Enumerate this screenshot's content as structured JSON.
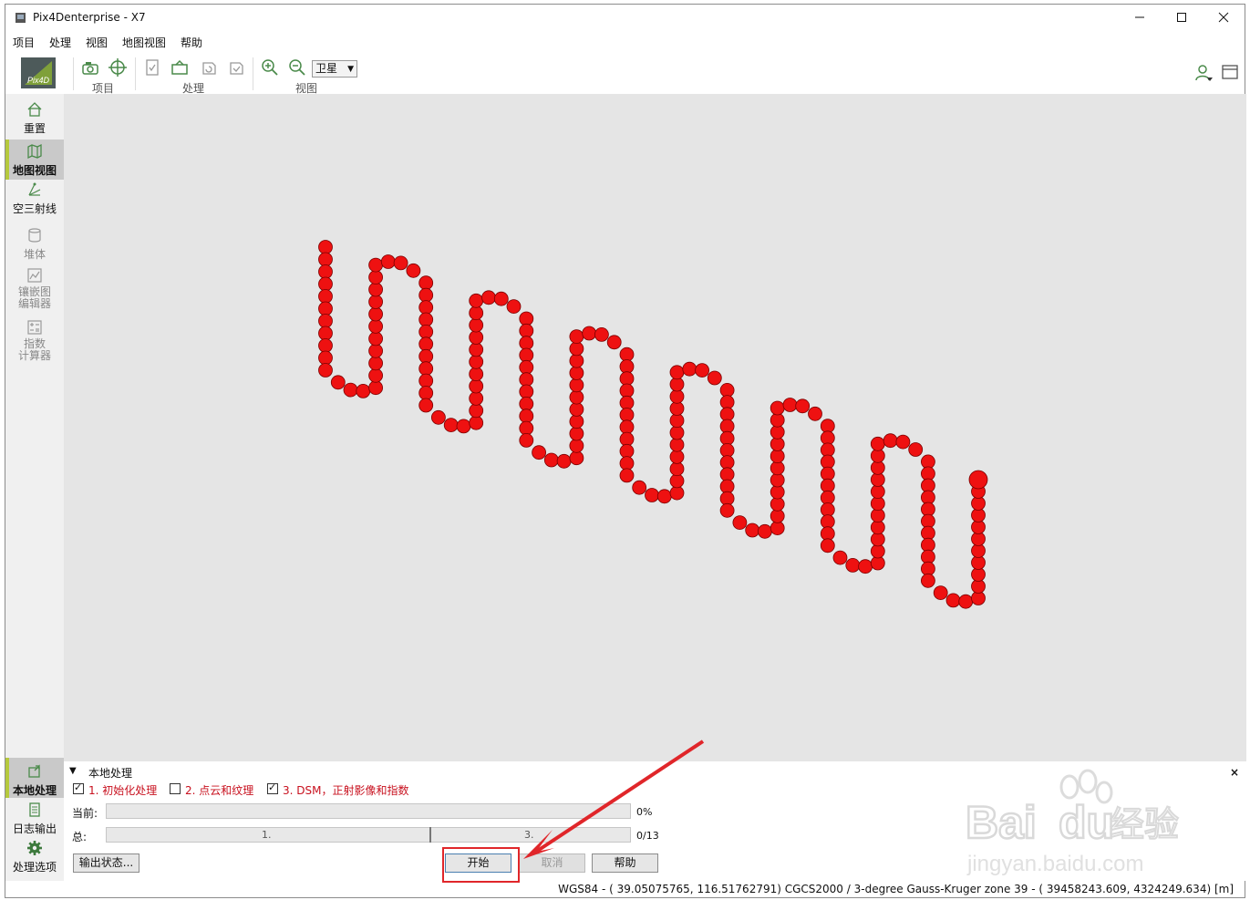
{
  "window": {
    "title": "Pix4Denterprise - X7"
  },
  "menu": [
    "项目",
    "处理",
    "视图",
    "地图视图",
    "帮助"
  ],
  "toolbar": {
    "groups": [
      {
        "label": "项目"
      },
      {
        "label": "处理"
      },
      {
        "label": "视图"
      }
    ],
    "basemap": "卫星"
  },
  "sidebar": {
    "items": [
      {
        "label": "重置",
        "icon": "home-icon",
        "state": "normal"
      },
      {
        "label": "地图视图",
        "icon": "map-icon",
        "state": "active"
      },
      {
        "label": "空三射线",
        "icon": "rays-icon",
        "state": "normal"
      },
      {
        "label": "堆体",
        "icon": "volume-icon",
        "state": "disabled"
      },
      {
        "label": "镶嵌图编辑器",
        "icon": "mosaic-editor-icon",
        "state": "disabled",
        "lines": [
          "镶嵌图",
          "编辑器"
        ]
      },
      {
        "label": "指数计算器",
        "icon": "index-calculator-icon",
        "state": "disabled",
        "lines": [
          "指数",
          "计算器"
        ]
      }
    ],
    "bottom_items": [
      {
        "label": "本地处理",
        "icon": "local-processing-icon",
        "state": "active"
      },
      {
        "label": "日志输出",
        "icon": "log-output-icon",
        "state": "normal"
      },
      {
        "label": "处理选项",
        "icon": "gear-icon",
        "state": "normal"
      }
    ]
  },
  "processing": {
    "title": "本地处理",
    "steps": [
      {
        "label": "1. 初始化处理",
        "checked": true
      },
      {
        "label": "2. 点云和纹理",
        "checked": false
      },
      {
        "label": "3. DSM，正射影像和指数",
        "checked": true
      }
    ],
    "current_label": "当前:",
    "current_progress": "0%",
    "total_label": "总:",
    "total_progress": "0/13",
    "total_segments": [
      "1.",
      "3."
    ],
    "buttons": {
      "output_status": "输出状态...",
      "start": "开始",
      "cancel": "取消",
      "help": "帮助"
    }
  },
  "status": {
    "coordinates": "WGS84 - ( 39.05075765,  116.51762791) CGCS2000 / 3-degree Gauss-Kruger zone 39 - ( 39458243.609,   4324249.634) [m]"
  },
  "watermark": {
    "brand": "Bai",
    "brand2": "du",
    "cn": "经验",
    "url": "jingyan.baidu.com"
  },
  "colors": {
    "camera_point": "#ee1111",
    "camera_stroke": "#7a0000",
    "accent": "#b6c93d",
    "annotation": "#e0262a",
    "map_bg": "#e5e5e5"
  },
  "flight_plan": {
    "description_points": "serpentine camera positions",
    "strips": 14,
    "top_y_first": 270,
    "top_y_last": 525,
    "bottom_y_first": 405,
    "bottom_y_last": 655
  }
}
